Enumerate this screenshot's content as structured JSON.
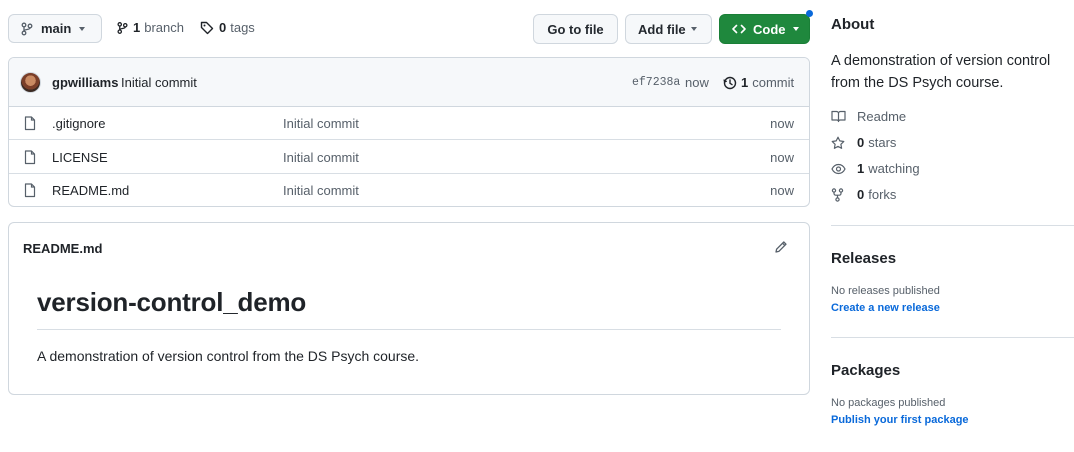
{
  "toolbar": {
    "branch_name": "main",
    "branch_count": "1",
    "branch_label": "branch",
    "tag_count": "0",
    "tag_label": "tags",
    "go_to_file": "Go to file",
    "add_file": "Add file",
    "code": "Code"
  },
  "latest_commit": {
    "author": "gpwilliams",
    "message": "Initial commit",
    "sha": "ef7238a",
    "time": "now",
    "commit_count": "1",
    "commit_label": "commit"
  },
  "files": [
    {
      "name": ".gitignore",
      "message": "Initial commit",
      "time": "now"
    },
    {
      "name": "LICENSE",
      "message": "Initial commit",
      "time": "now"
    },
    {
      "name": "README.md",
      "message": "Initial commit",
      "time": "now"
    }
  ],
  "readme": {
    "filename": "README.md",
    "heading": "version-control_demo",
    "body": "A demonstration of version control from the DS Psych course."
  },
  "about": {
    "title": "About",
    "description": "A demonstration of version control from the DS Psych course.",
    "readme_label": "Readme",
    "stars_count": "0",
    "stars_label": "stars",
    "watching_count": "1",
    "watching_label": "watching",
    "forks_count": "0",
    "forks_label": "forks"
  },
  "releases": {
    "title": "Releases",
    "empty_text": "No releases published",
    "link": "Create a new release"
  },
  "packages": {
    "title": "Packages",
    "empty_text": "No packages published",
    "link": "Publish your first package"
  },
  "colors": {
    "accent_green": "#1f883d",
    "link_blue": "#0969da",
    "border": "#d0d7de",
    "notification_dot": "#0969da"
  }
}
